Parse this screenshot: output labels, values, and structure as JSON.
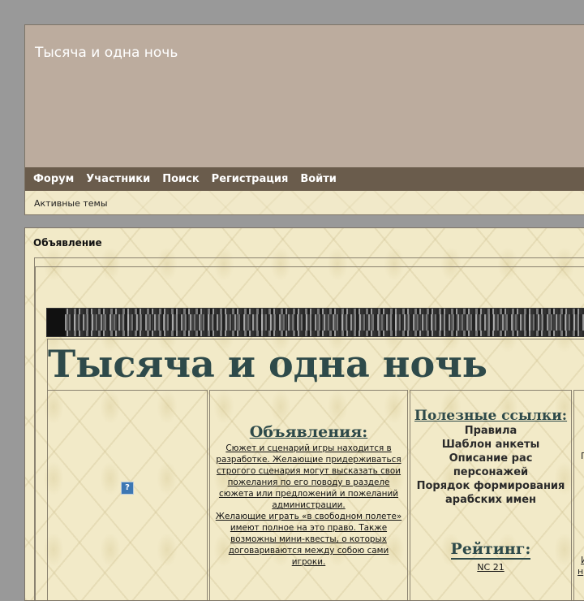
{
  "header": {
    "site_title": "Тысяча и одна ночь",
    "nav": [
      "Форум",
      "Участники",
      "Поиск",
      "Регистрация",
      "Войти"
    ],
    "subnav": {
      "active_topics": "Активные темы"
    }
  },
  "announcement": {
    "heading": "Объявление",
    "big_title": "Тысяча и одна ночь",
    "help_icon": "?",
    "announcements": {
      "title": "Объявления:",
      "text1": "Сюжет и сценарий игры находится в разработке. Желающие придерживаться строгого сценария могут высказать свои пожелания по его поводу в разделе сюжета или предложений и пожеланий администрации.",
      "text2": "Желающие играть «в свободном полете» имеют полное на это право. Также возможны мини-квесты, о которых договариваются между собою сами игроки."
    },
    "useful_links": {
      "title": "Полезные ссылки:",
      "items": [
        "Правила",
        "Шаблон анкеты",
        "Описание рас персонажей",
        "Порядок формирования арабских имен"
      ]
    },
    "rating": {
      "title": "Рейтинг:",
      "value": "NC 21"
    },
    "col4_fragments": [
      "П",
      "И",
      "н"
    ]
  },
  "colors": {
    "page_bg": "#999999",
    "title_band": "#bcac9e",
    "nav_bar": "#6a5c4c",
    "parchment": "#f2eac8",
    "title_text": "#2e4a4a"
  },
  "icons": {
    "help": "help-icon",
    "banner": "ornamental-banner"
  }
}
